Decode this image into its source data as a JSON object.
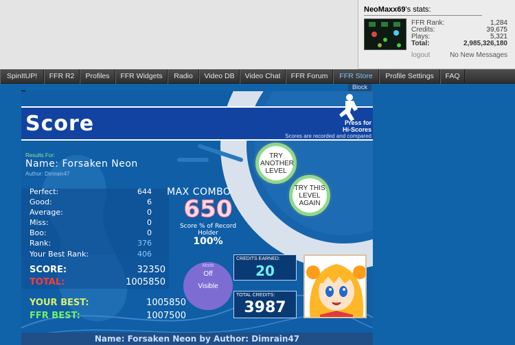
{
  "user_stats": {
    "title_user": "NeoMaxx69",
    "title_suffix": "'s stats:",
    "rank_label": "FFR Rank:",
    "rank_value": "1,284",
    "credits_label": "Credits:",
    "credits_value": "39,675",
    "plays_label": "Plays:",
    "plays_value": "5,321",
    "total_label": "Total:",
    "total_value": "2,985,326,180",
    "logout": "logout",
    "messages": "No New Messages"
  },
  "nav": [
    "SpinItUP!",
    "FFR R2",
    "Profiles",
    "FFR Widgets",
    "Radio",
    "Video DB",
    "Video Chat",
    "FFR Forum",
    "FFR Store",
    "Profile Settings",
    "FAQ"
  ],
  "block_label": "Block",
  "game": {
    "heading": "Score",
    "press_for": "Press for",
    "hi_scores": "Hi-Scores",
    "recorded_note": "Scores are recorded and compared",
    "results_for": "Results For:",
    "name": "Name: Forsaken Neon",
    "author": "Author: Dimrain47",
    "try_another": "TRY ANOTHER LEVEL",
    "try_again": "TRY THIS LEVEL AGAIN",
    "stats": [
      {
        "label": "Perfect:",
        "value": "644"
      },
      {
        "label": "Good:",
        "value": "6"
      },
      {
        "label": "Average:",
        "value": "0"
      },
      {
        "label": "Miss:",
        "value": "0"
      },
      {
        "label": "Boo:",
        "value": "0"
      },
      {
        "label": "Rank:",
        "value": "376"
      },
      {
        "label": "Your Best Rank:",
        "value": "406"
      }
    ],
    "max_combo_label": "MAX COMBO",
    "max_combo_value": "650",
    "score_pct_label": "Score % of Record Holder",
    "score_pct_value": "100%",
    "score_label": "SCORE:",
    "score_value": "32350",
    "total_label": "TOTAL:",
    "total_value": "1005850",
    "your_best_label": "YOUR BEST:",
    "your_best_value": "1005850",
    "ffr_best_label": "FFR BEST:",
    "ffr_best_value": "1007500",
    "mods_label": "Mods",
    "mods_off": "Off",
    "mods_visible": "Visible",
    "credits_earned_label": "CREDITS EARNED:",
    "credits_earned_value": "20",
    "total_credits_label": "TOTAL CREDITS:",
    "total_credits_value": "3987",
    "footer": "Name: Forsaken Neon by Author: Dimrain47"
  }
}
